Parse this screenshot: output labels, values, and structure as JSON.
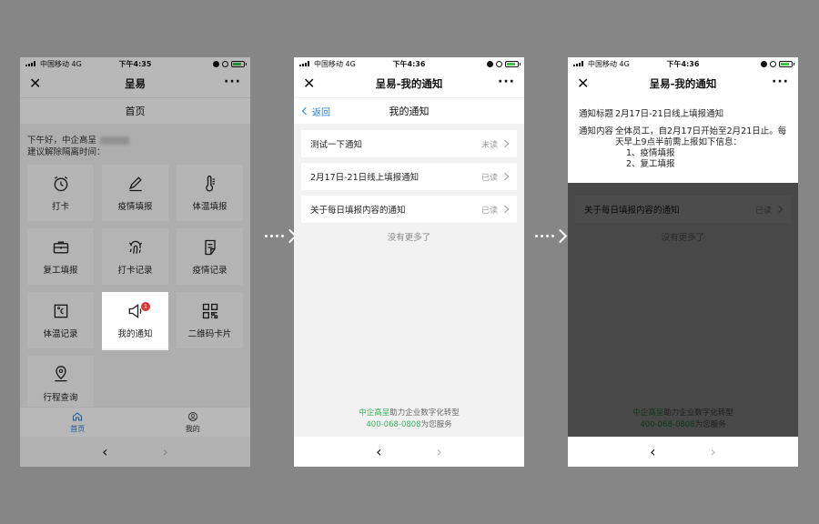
{
  "status_bar": {
    "carrier": "中国移动",
    "network": "4G",
    "time1": "下午4:35",
    "time2": "下午4:36",
    "time3": "下午4:36"
  },
  "screen1": {
    "nav_title": "呈易",
    "sub_title": "首页",
    "greeting_line1": "下午好，中企高呈",
    "greeting_line2": "建议解除隔离时间：",
    "tiles": [
      {
        "label": "打卡",
        "icon": "alarm-clock-icon"
      },
      {
        "label": "疫情填报",
        "icon": "pen-icon"
      },
      {
        "label": "体温填报",
        "icon": "thermometer-icon"
      },
      {
        "label": "复工填报",
        "icon": "briefcase-icon"
      },
      {
        "label": "打卡记录",
        "icon": "fingerprint-icon"
      },
      {
        "label": "疫情记录",
        "icon": "clipboard-icon"
      },
      {
        "label": "体温记录",
        "icon": "celsius-icon"
      },
      {
        "label": "我的通知",
        "icon": "megaphone-icon"
      },
      {
        "label": "二维码卡片",
        "icon": "qrcode-icon"
      },
      {
        "label": "行程查询",
        "icon": "location-pin-icon"
      }
    ],
    "badge_count": "1",
    "tab_home": "首页",
    "tab_mine": "我的"
  },
  "screen2": {
    "nav_title": "呈易-我的通知",
    "back_label": "返回",
    "sub_title": "我的通知",
    "notices": [
      {
        "title": "测试一下通知",
        "status": "未读"
      },
      {
        "title": "2月17日-21日线上填报通知",
        "status": "已读"
      },
      {
        "title": "关于每日填报内容的通知",
        "status": "已读"
      }
    ],
    "no_more": "没有更多了",
    "footer_brand": "中企高呈",
    "footer_line1": "助力企业数字化转型",
    "footer_phone": "400-068-0808",
    "footer_line2": "为您服务"
  },
  "screen3": {
    "nav_title": "呈易-我的通知",
    "title_label": "通知标题",
    "title_value": "2月17日-21日线上填报通知",
    "content_label": "通知内容",
    "content_value": "全体员工，自2月17日开始至2月21日止。每天早上9点半前需上报如下信息：",
    "content_item1": "1、疫情填报",
    "content_item2": "2、复工填报"
  },
  "colors": {
    "accent_blue": "#2a7ad9",
    "brand_green": "#3cb15b",
    "badge_red": "#e8312f"
  }
}
